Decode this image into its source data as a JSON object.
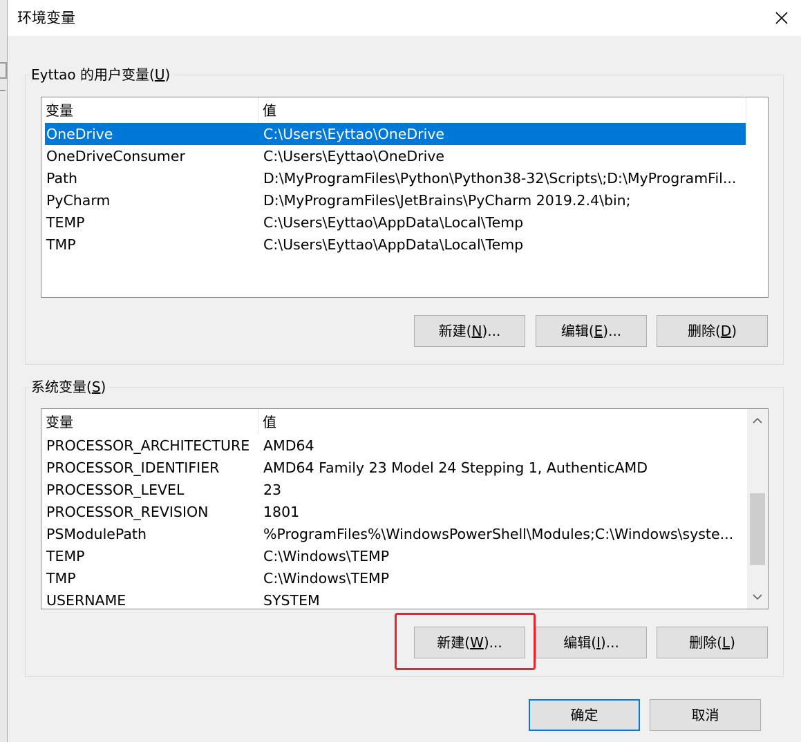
{
  "window": {
    "title": "环境变量"
  },
  "user_vars": {
    "group_label_prefix": "Eyttao 的用户变量(",
    "group_label_key": "U",
    "group_label_suffix": ")",
    "columns": [
      "变量",
      "值"
    ],
    "rows": [
      {
        "name": "OneDrive",
        "value": "C:\\Users\\Eyttao\\OneDrive",
        "selected": true
      },
      {
        "name": "OneDriveConsumer",
        "value": "C:\\Users\\Eyttao\\OneDrive"
      },
      {
        "name": "Path",
        "value": "D:\\MyProgramFiles\\Python\\Python38-32\\Scripts\\;D:\\MyProgramFil..."
      },
      {
        "name": "PyCharm",
        "value": "D:\\MyProgramFiles\\JetBrains\\PyCharm 2019.2.4\\bin;"
      },
      {
        "name": "TEMP",
        "value": "C:\\Users\\Eyttao\\AppData\\Local\\Temp"
      },
      {
        "name": "TMP",
        "value": "C:\\Users\\Eyttao\\AppData\\Local\\Temp"
      }
    ],
    "buttons": {
      "new": {
        "prefix": "新建(",
        "key": "N",
        "suffix": ")..."
      },
      "edit": {
        "prefix": "编辑(",
        "key": "E",
        "suffix": ")..."
      },
      "delete": {
        "prefix": "删除(",
        "key": "D",
        "suffix": ")"
      }
    }
  },
  "system_vars": {
    "group_label_prefix": "系统变量(",
    "group_label_key": "S",
    "group_label_suffix": ")",
    "columns": [
      "变量",
      "值"
    ],
    "rows": [
      {
        "name": "PROCESSOR_ARCHITECTURE",
        "value": "AMD64"
      },
      {
        "name": "PROCESSOR_IDENTIFIER",
        "value": "AMD64 Family 23 Model 24 Stepping 1, AuthenticAMD"
      },
      {
        "name": "PROCESSOR_LEVEL",
        "value": "23"
      },
      {
        "name": "PROCESSOR_REVISION",
        "value": "1801"
      },
      {
        "name": "PSModulePath",
        "value": "%ProgramFiles%\\WindowsPowerShell\\Modules;C:\\Windows\\syste..."
      },
      {
        "name": "TEMP",
        "value": "C:\\Windows\\TEMP"
      },
      {
        "name": "TMP",
        "value": "C:\\Windows\\TEMP"
      },
      {
        "name": "USERNAME",
        "value": "SYSTEM"
      }
    ],
    "buttons": {
      "new": {
        "prefix": "新建(",
        "key": "W",
        "suffix": ")..."
      },
      "edit": {
        "prefix": "编辑(",
        "key": "I",
        "suffix": ")..."
      },
      "delete": {
        "prefix": "删除(",
        "key": "L",
        "suffix": ")"
      }
    }
  },
  "footer": {
    "ok": "确定",
    "cancel": "取消"
  },
  "colors": {
    "selection": "#0078d7",
    "highlight": "#e8232a"
  }
}
